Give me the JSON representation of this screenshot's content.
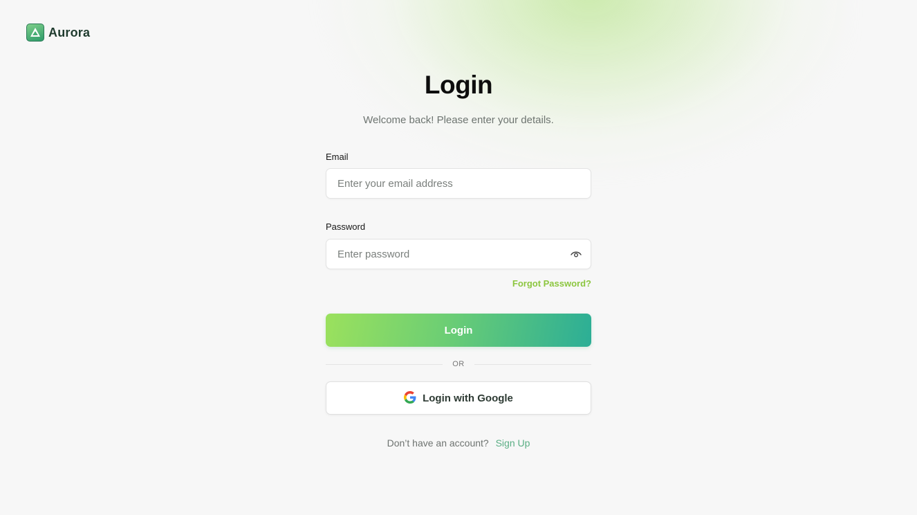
{
  "brand": {
    "name": "Aurora"
  },
  "login": {
    "title": "Login",
    "subtitle": "Welcome back! Please enter your details.",
    "email": {
      "label": "Email",
      "placeholder": "Enter your email address",
      "value": ""
    },
    "password": {
      "label": "Password",
      "placeholder": "Enter password",
      "value": ""
    },
    "forgot_password": "Forgot Password?",
    "submit_label": "Login",
    "divider": "OR",
    "google_label": "Login with Google",
    "signup_prompt": "Don’t have an account?",
    "signup_link": "Sign Up"
  },
  "icons": {
    "logo": "aurora-logo-icon",
    "eye": "eye-icon",
    "google": "google-icon"
  },
  "colors": {
    "accent": "#8cc63f",
    "gradient_start": "#9be15d",
    "gradient_end": "#2cae96",
    "signup_link": "#5aae84",
    "brand_text": "#1f3b2e"
  }
}
